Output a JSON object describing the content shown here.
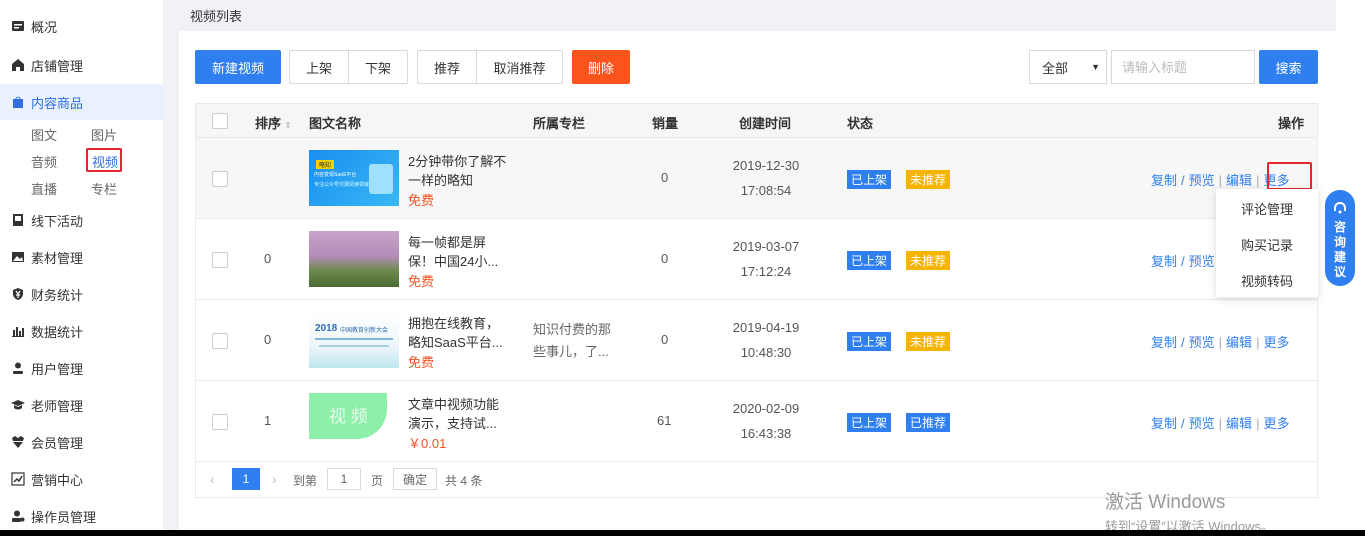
{
  "sidebar": {
    "items": [
      {
        "label": "概况",
        "icon": "overview-icon"
      },
      {
        "label": "店铺管理",
        "icon": "store-icon"
      },
      {
        "label": "内容商品",
        "icon": "shopping-bag-icon"
      },
      {
        "label": "线下活动",
        "icon": "flag-icon"
      },
      {
        "label": "素材管理",
        "icon": "image-icon"
      },
      {
        "label": "财务统计",
        "icon": "yen-shield-icon"
      },
      {
        "label": "数据统计",
        "icon": "bar-chart-icon"
      },
      {
        "label": "用户管理",
        "icon": "user-icon"
      },
      {
        "label": "老师管理",
        "icon": "graduation-cap-icon"
      },
      {
        "label": "会员管理",
        "icon": "vip-icon"
      },
      {
        "label": "营销中心",
        "icon": "trend-icon"
      },
      {
        "label": "操作员管理",
        "icon": "operator-icon"
      }
    ],
    "sub": {
      "article": "图文",
      "image": "图片",
      "audio": "音频",
      "video": "视频",
      "live": "直播",
      "column": "专栏"
    }
  },
  "header": {
    "breadcrumb": "视频列表"
  },
  "toolbar": {
    "new_video": "新建视频",
    "on_shelf": "上架",
    "off_shelf": "下架",
    "recommend": "推荐",
    "cancel_recommend": "取消推荐",
    "delete": "删除",
    "filter_value": "全部",
    "search_placeholder": "请输入标题",
    "search": "搜索"
  },
  "table": {
    "headers": {
      "sort": "排序",
      "name": "图文名称",
      "column": "所属专栏",
      "sales": "销量",
      "created": "创建时间",
      "status": "状态",
      "ops": "操作"
    },
    "rows": [
      {
        "sort": "",
        "title": "2分钟带你了解不一样的略知",
        "price": "免费",
        "column": "",
        "sales": "0",
        "date": "2019-12-30",
        "time": "17:08:54",
        "status": "已上架",
        "rec": "未推荐"
      },
      {
        "sort": "0",
        "title": "每一帧都是屏保！中国24小...",
        "price": "免费",
        "column": "",
        "sales": "0",
        "date": "2019-03-07",
        "time": "17:12:24",
        "status": "已上架",
        "rec": "未推荐"
      },
      {
        "sort": "0",
        "title": "拥抱在线教育，略知SaaS平台...",
        "price": "免费",
        "column": "知识付费的那些事儿，了...",
        "sales": "0",
        "date": "2019-04-19",
        "time": "10:48:30",
        "status": "已上架",
        "rec": "未推荐"
      },
      {
        "sort": "1",
        "title": "文章中视频功能演示，支持试...",
        "price": "￥0.01",
        "column": "",
        "sales": "61",
        "date": "2020-02-09",
        "time": "16:43:38",
        "status": "已上架",
        "rec": "已推荐"
      }
    ],
    "ops": {
      "copy": "复制",
      "preview": "预览",
      "edit": "编辑",
      "more": "更多"
    }
  },
  "thumbs": {
    "row1_badge": "略知",
    "row1_line1": "內容变现SaaS平台",
    "row1_line2": "专注公众号付费阅读领域",
    "row3_year": "2018",
    "row3_caption": "中国教育创新大会",
    "row4_text": "视 频"
  },
  "pager": {
    "current": "1",
    "goto_label": "到第",
    "page_input": "1",
    "page_label": "页",
    "confirm": "确定",
    "total": "共 4 条"
  },
  "dropdown": {
    "items": [
      "评论管理",
      "购买记录",
      "视频转码"
    ]
  },
  "consult": {
    "chars": [
      "咨",
      "询",
      "建",
      "议"
    ]
  },
  "watermark": {
    "line1": "激活 Windows",
    "line2": "转到“设置”以激活 Windows。"
  },
  "colors": {
    "primary": "#2f7ff0",
    "danger": "#fa541c",
    "warning": "#f5b400",
    "highlight": "#e0282e"
  }
}
